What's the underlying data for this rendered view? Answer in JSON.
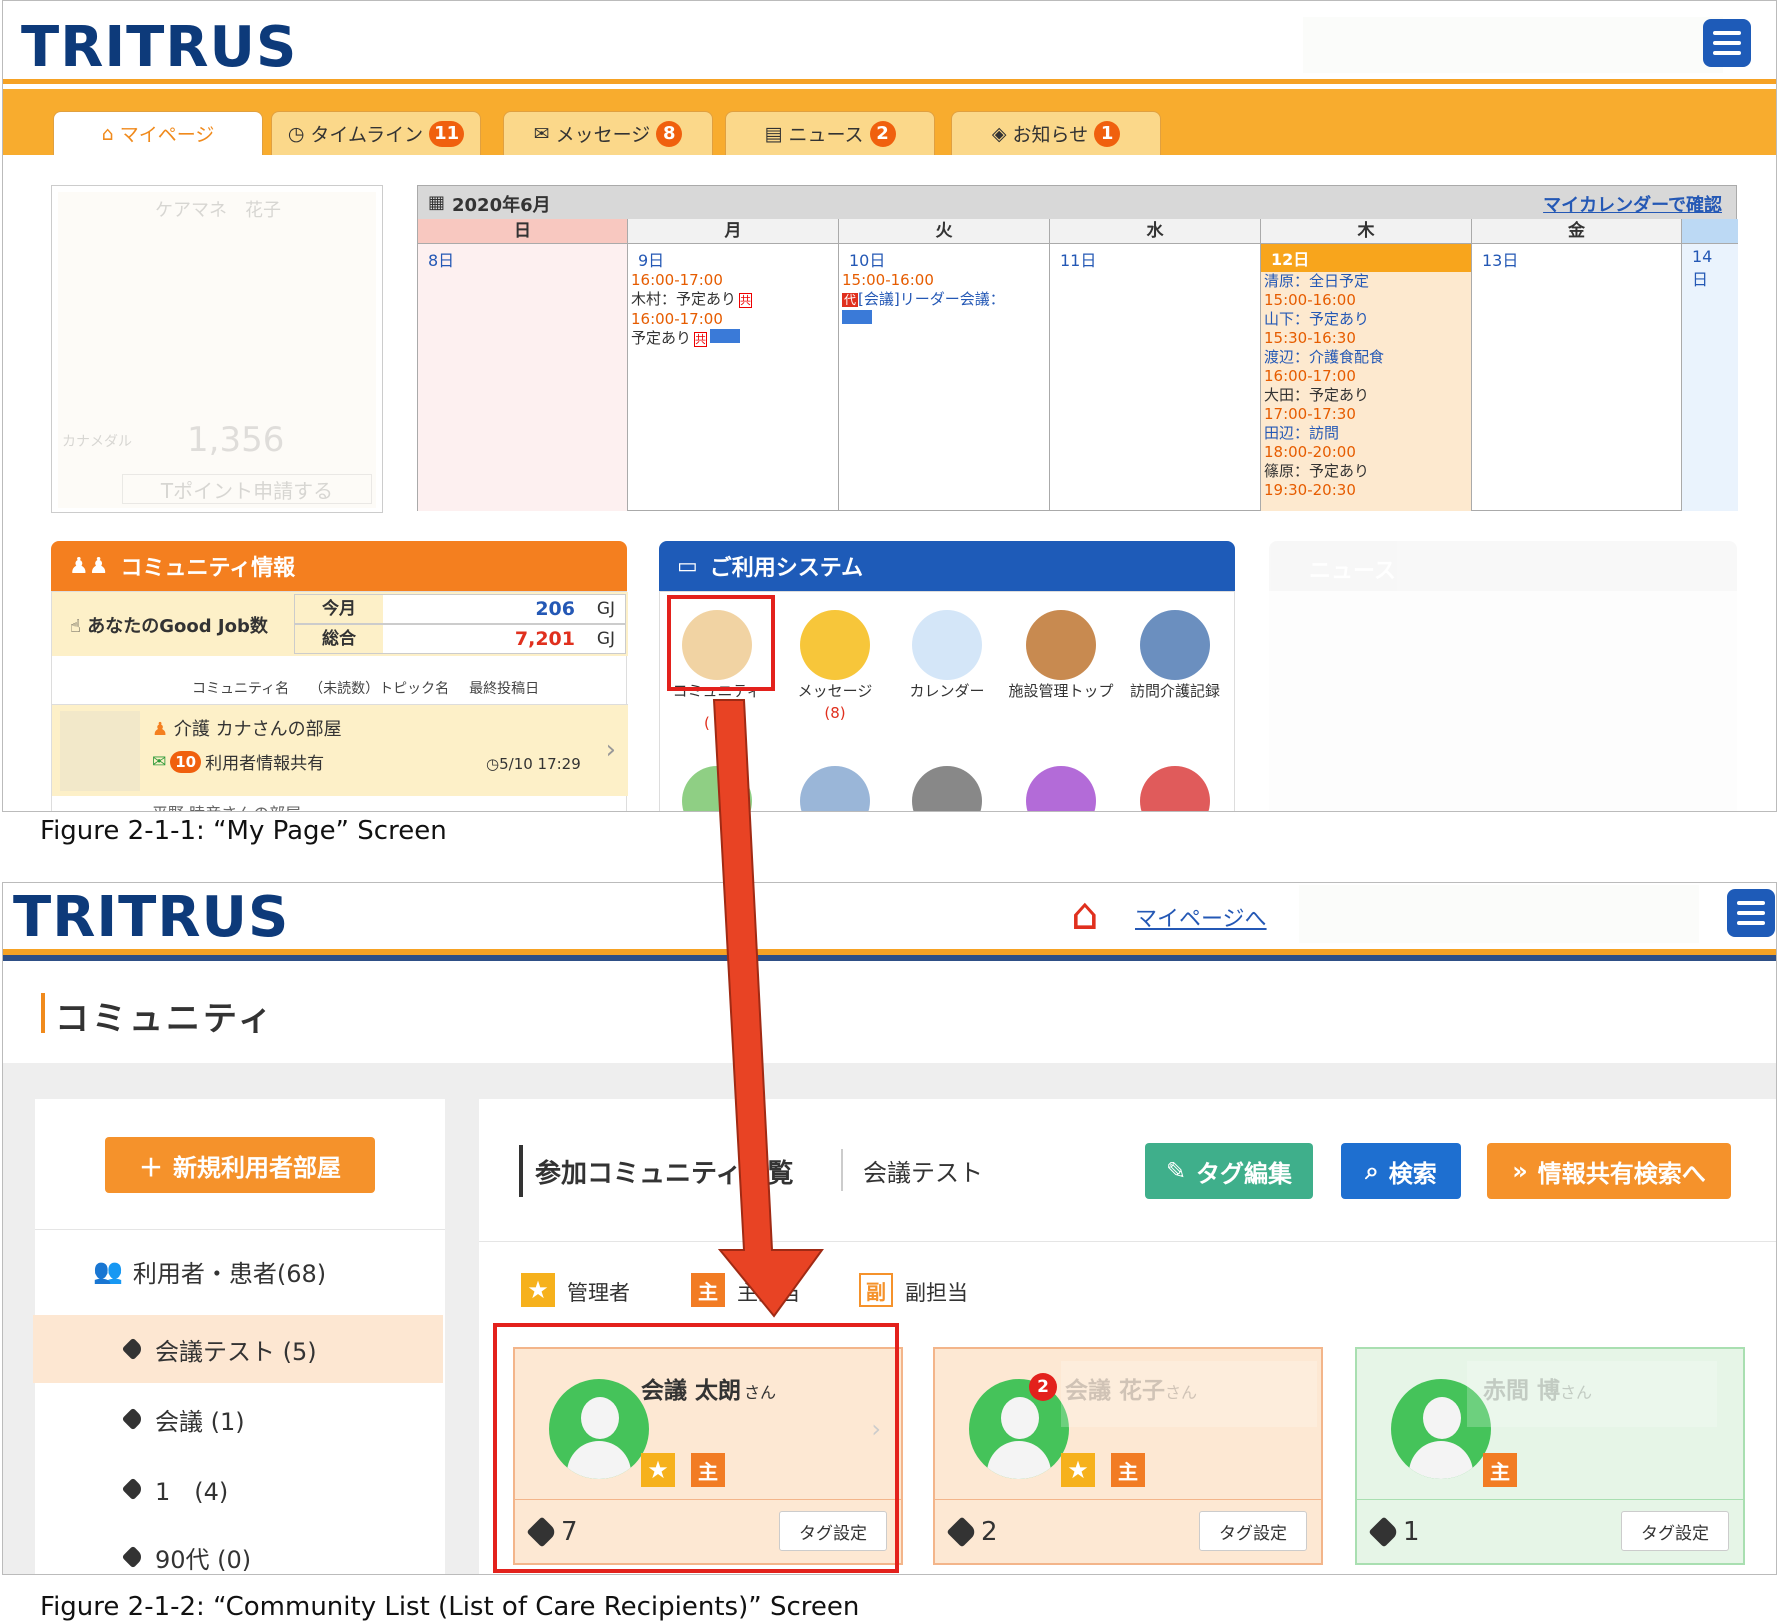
{
  "fig1": {
    "logo": "TRITRUS",
    "tabs": [
      {
        "label": "マイページ"
      },
      {
        "label": "タイムライン",
        "badge": "11"
      },
      {
        "label": "メッセージ",
        "badge": "8"
      },
      {
        "label": "ニュース",
        "badge": "2"
      },
      {
        "label": "お知らせ",
        "badge": "1"
      }
    ],
    "profile": {
      "name": "ケアマネ　花子",
      "medal_label": "カナメダル",
      "points": "1,356",
      "apply": "Tポイント申請する"
    },
    "calendar": {
      "month": "2020年6月",
      "link": "マイカレンダーで確認",
      "days": [
        "日",
        "月",
        "火",
        "水",
        "木",
        "金"
      ],
      "dates": [
        "8日",
        "9日",
        "10日",
        "11日",
        "12日",
        "13日",
        "14日"
      ],
      "mon_events": [
        "16:00-17:00",
        "木村：予定あり",
        "16:00-17:00",
        "予定あり"
      ],
      "tue_events": [
        "15:00-16:00",
        "[会議]リーダー会議："
      ],
      "thu_events": [
        "清原：全日予定",
        "15:00-16:00",
        "山下：予定あり",
        "15:30-16:30",
        "渡辺：介護食配食",
        "16:00-17:00",
        "大田：予定あり",
        "17:00-17:30",
        "田辺：訪問",
        "18:00-20:00",
        "篠原：予定あり",
        "19:30-20:30"
      ],
      "tags": {
        "kyo": "共",
        "dai": "代"
      }
    },
    "community": {
      "title": "コミュニティ情報",
      "goodjob_label": "あなたのGood Job数",
      "today_label": "今月",
      "today_value": "206",
      "total_label": "総合",
      "total_value": "7,201",
      "unit": "GJ",
      "cols": [
        "コミュニティ名",
        "（未読数）トピック名",
        "最終投稿日"
      ],
      "item_name": "介護 カナさんの部屋",
      "item_unread": "10",
      "item_topic": "利用者情報共有",
      "item_date": "5/10 17:29",
      "next_item": "平野 睦彦さんの部屋"
    },
    "systems": {
      "title": "ご利用システム",
      "items": [
        {
          "label": "コミュニティ"
        },
        {
          "label": "メッセージ",
          "count": "(8)"
        },
        {
          "label": "カレンダー"
        },
        {
          "label": "施設管理トップ"
        },
        {
          "label": "訪問介護記録"
        }
      ],
      "badge_partial": "("
    },
    "news": {
      "title": "ニュース"
    },
    "caption": "Figure 2-1-1: “My Page” Screen"
  },
  "fig2": {
    "logo": "TRITRUS",
    "mypage_link": "マイページへ",
    "page_title": "コミュニティ",
    "new_room_btn": "新規利用者部屋",
    "sidebar": [
      {
        "label": "利用者・患者(68)"
      },
      {
        "label": "会議テスト (5)"
      },
      {
        "label": "会議 (1)"
      },
      {
        "label": "1　(4)"
      },
      {
        "label": "90代 (0)"
      }
    ],
    "section_title": "参加コミュニティ一覧",
    "section_sub": "会議テスト",
    "buttons": {
      "tag_edit": "タグ編集",
      "search": "検索",
      "info_search": "情報共有検索へ"
    },
    "legend": {
      "admin": "管理者",
      "main": "主担当",
      "sub": "副担当",
      "main_char": "主",
      "sub_char": "副"
    },
    "cards": [
      {
        "name": "会議 太朗",
        "suffix": "さん",
        "tag_count": "7",
        "tag_btn": "タグ設定"
      },
      {
        "name": "会議 花子",
        "suffix": "さん",
        "tag_count": "2",
        "tag_btn": "タグ設定",
        "badge": "2"
      },
      {
        "name": "赤間 博",
        "suffix": "さん",
        "tag_count": "1",
        "tag_btn": "タグ設定"
      }
    ],
    "caption": "Figure 2-1-2: “Community List (List of Care Recipients)” Screen"
  },
  "colors": {
    "orange": "#f6a224",
    "navy": "#0d3a7a",
    "blue": "#1e5bb8",
    "red_box": "#e3211c",
    "arrow": "#e84324"
  }
}
